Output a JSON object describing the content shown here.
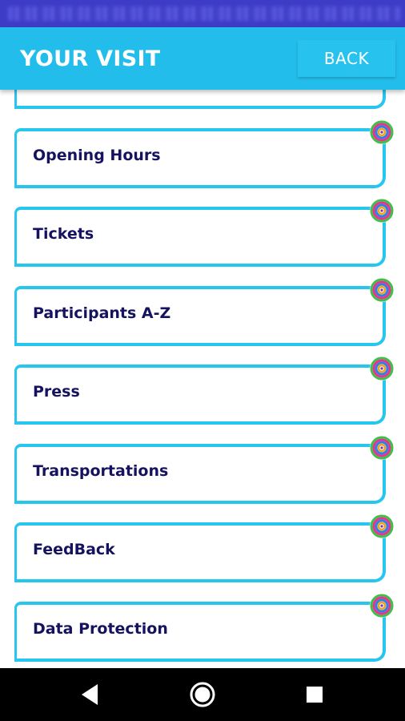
{
  "header": {
    "title": "YOUR VISIT",
    "back_label": "BACK"
  },
  "menu": {
    "items": [
      {
        "label": "Opening Hours"
      },
      {
        "label": "Tickets"
      },
      {
        "label": "Participants A-Z"
      },
      {
        "label": "Press"
      },
      {
        "label": "Transportations"
      },
      {
        "label": "FeedBack"
      },
      {
        "label": "Data Protection"
      }
    ]
  },
  "colors": {
    "app_bar": "#22bdea",
    "card_border": "#27c6ee",
    "label_text": "#15135f",
    "status_bar": "#3d3cc7"
  },
  "icons": {
    "card_badge": "rose-flower-icon",
    "nav_back": "back-triangle-icon",
    "nav_home": "home-circle-icon",
    "nav_recents": "recents-square-icon"
  }
}
